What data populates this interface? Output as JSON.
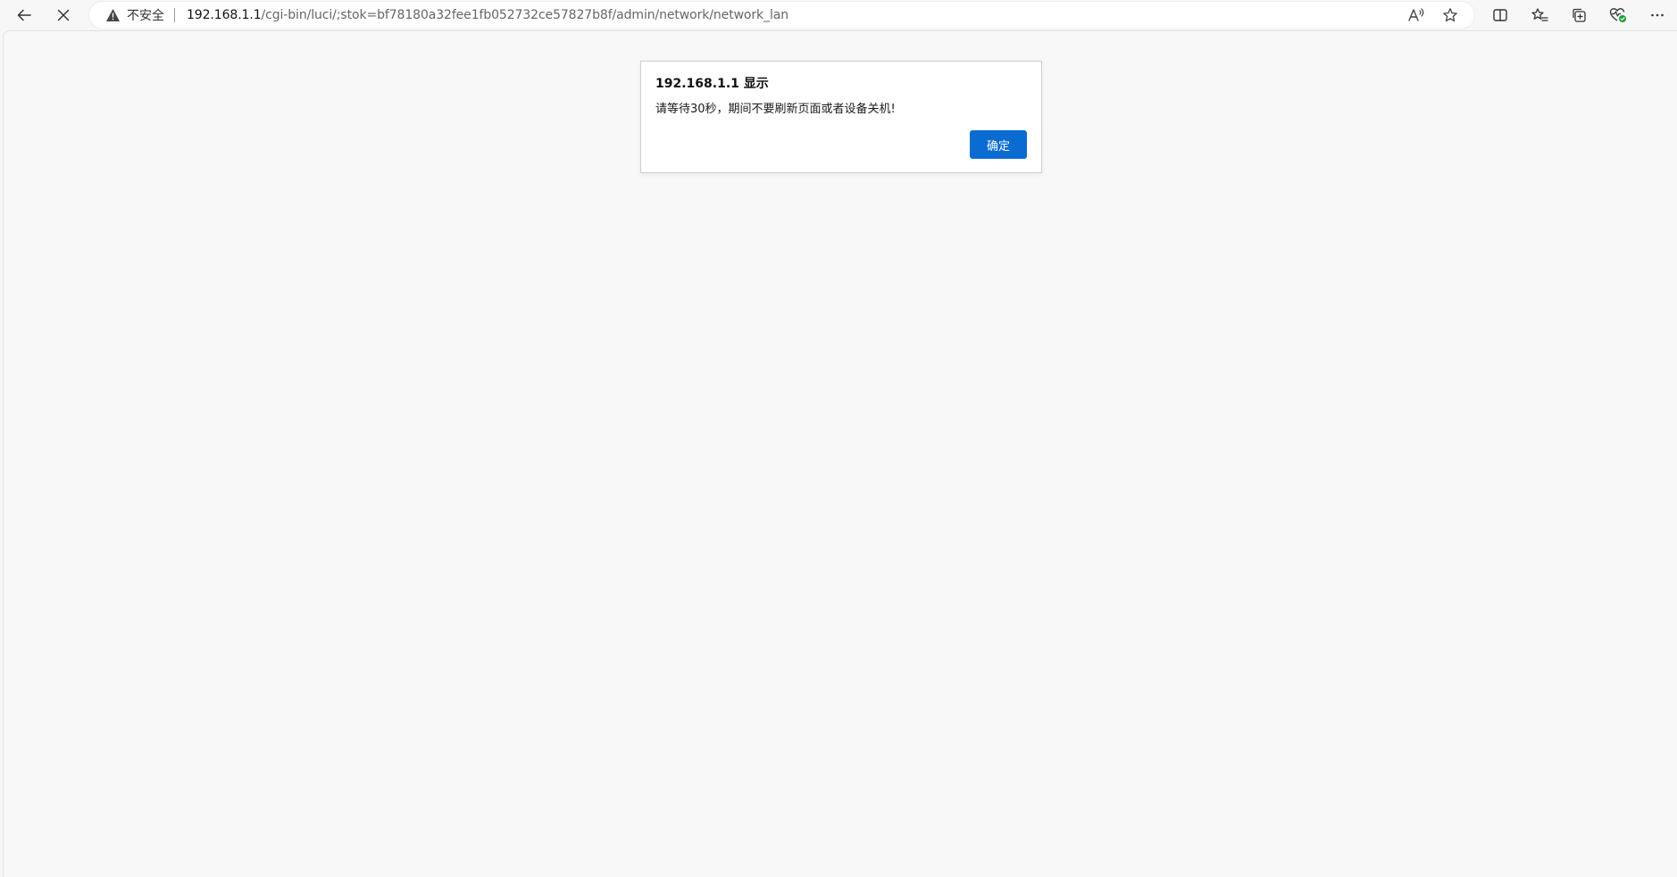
{
  "browser": {
    "security_label": "不安全",
    "url_host": "192.168.1.1",
    "url_path": "/cgi-bin/luci/;stok=bf78180a32fee1fb052732ce57827b8f/admin/network/network_lan",
    "icons": {
      "back": "arrow-left-icon",
      "stop": "close-icon",
      "warning": "warning-triangle-icon",
      "read_aloud": "read-aloud-icon",
      "favorite": "star-icon",
      "split_screen": "split-screen-icon",
      "favorites": "favorites-list-icon",
      "collections": "collections-icon",
      "browser_essentials": "heart-pulse-icon",
      "more": "more-dots-icon"
    },
    "accent_green": "#1a9e3a"
  },
  "dialog": {
    "title": "192.168.1.1 显示",
    "message": "请等待30秒，期间不要刷新页面或者设备关机!",
    "ok_label": "确定",
    "button_color": "#0a6cd1"
  }
}
